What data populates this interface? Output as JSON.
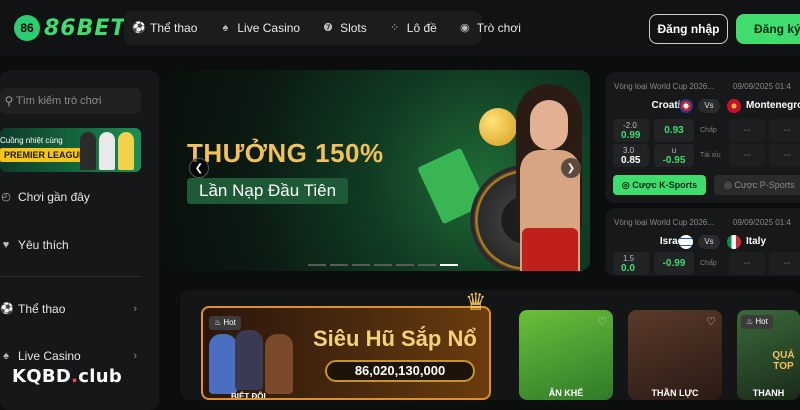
{
  "brand": {
    "name": "86BET",
    "badge": "86"
  },
  "nav": {
    "items": [
      {
        "label": "Thể thao",
        "icon": "soccer-ball-icon"
      },
      {
        "label": "Live Casino",
        "icon": "casino-chip-icon"
      },
      {
        "label": "Slots",
        "icon": "slot-machine-icon"
      },
      {
        "label": "Lô đề",
        "icon": "lottery-balls-icon"
      },
      {
        "label": "Trò chơi",
        "icon": "game-controller-icon"
      }
    ]
  },
  "auth": {
    "login": "Đăng nhập",
    "register": "Đăng ký"
  },
  "sidebar": {
    "search_placeholder": "Tìm kiếm trò chơi",
    "promo_line1": "Cuồng nhiệt cùng",
    "promo_line2": "PREMIER LEAGUE",
    "items": [
      {
        "label": "Chơi gần đây",
        "icon": "clock-icon"
      },
      {
        "label": "Yêu thích",
        "icon": "heart-icon"
      },
      {
        "label": "Thể thao",
        "icon": "soccer-ball-icon"
      },
      {
        "label": "Live Casino",
        "icon": "casino-chip-icon"
      }
    ]
  },
  "banner": {
    "headline": "THƯỞNG 150%",
    "subline": "Lần Nạp Đầu Tiên",
    "slides_total": 7,
    "active_slide": 7
  },
  "matches": [
    {
      "competition": "Vòng loại World Cup 2026...",
      "date": "09/09/2025",
      "time": "01:4",
      "home": "Croatia",
      "away": "Montenegro",
      "vs": "Vs",
      "odds_left": [
        {
          "top": "-2.0",
          "bottom": "0.99"
        },
        {
          "top": "3.0",
          "bottom": "0.85"
        }
      ],
      "odds_center": [
        {
          "top": "",
          "bottom": "0.93"
        },
        {
          "top": "u",
          "bottom": "-0.95"
        }
      ],
      "labels": [
        "Chấp",
        "Tài xỉu"
      ],
      "empty": "--",
      "cta_primary": "Cược K-Sports",
      "cta_secondary": "Cược P-Sports"
    },
    {
      "competition": "Vòng loại World Cup 2026...",
      "date": "09/09/2025",
      "time": "01:4",
      "home": "Israel",
      "away": "Italy",
      "vs": "Vs",
      "odds_left": [
        {
          "top": "1.5",
          "bottom": "0.0"
        }
      ],
      "odds_center": [
        {
          "top": "",
          "bottom": "-0.99"
        }
      ],
      "labels": [
        "Chấp"
      ],
      "empty": "--"
    }
  ],
  "games": {
    "jackpot_title": "Siêu Hũ Sắp Nổ",
    "jackpot_amount": "86,020,130,000",
    "hot_badge": "Hot",
    "cards": [
      {
        "label": "BIỆT ĐỘI",
        "hot": true
      },
      {
        "label": "ĂN KHẾ",
        "hot": false
      },
      {
        "label": "THẦN LỰC",
        "hot": false
      },
      {
        "label": "THANH",
        "hot": true
      }
    ],
    "card_tag": "QUÁ TOP"
  },
  "watermark": {
    "prefix": "KQBD",
    "dot": ".",
    "suffix": "club"
  },
  "colors": {
    "accent": "#3fdc6e",
    "gold": "#f3c05a",
    "background": "#0c0d0d"
  }
}
